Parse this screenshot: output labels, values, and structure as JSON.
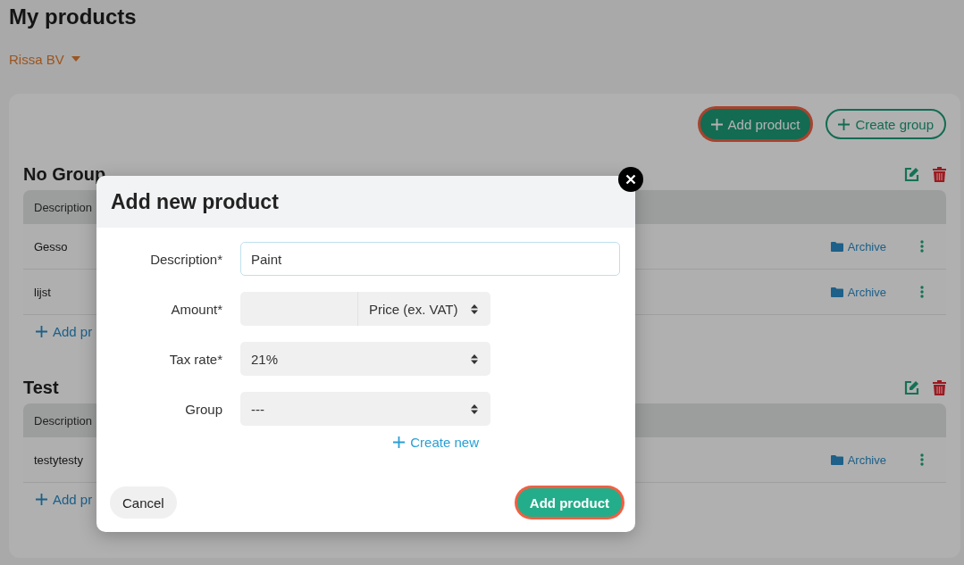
{
  "page": {
    "title": "My products",
    "company": "Rissa BV"
  },
  "toolbar": {
    "buttons": [
      {
        "label": "Add product",
        "kind": "primary",
        "highlighted": true
      },
      {
        "label": "Create group",
        "kind": "outline",
        "highlighted": false
      }
    ]
  },
  "groups": [
    {
      "name": "No Group",
      "column": "Description",
      "rows": [
        {
          "description": "Gesso",
          "action": "Archive"
        },
        {
          "description": "lijst",
          "action": "Archive"
        }
      ],
      "add_link": "Add pr"
    },
    {
      "name": "Test",
      "column": "Description",
      "rows": [
        {
          "description": "testytesty",
          "action": "Archive"
        }
      ],
      "add_link": "Add pr"
    }
  ],
  "dialog": {
    "title": "Add new product",
    "fields": [
      {
        "kind": "text",
        "label": "Description*",
        "value": "Paint"
      },
      {
        "kind": "amount",
        "label": "Amount*",
        "unit": "Price (ex. VAT)"
      },
      {
        "kind": "select",
        "label": "Tax rate*",
        "value": "21%"
      },
      {
        "kind": "select",
        "label": "Group",
        "value": "---"
      }
    ],
    "create_link": "Create new",
    "cancel": "Cancel",
    "submit": {
      "label": "Add product",
      "highlighted": true
    }
  }
}
